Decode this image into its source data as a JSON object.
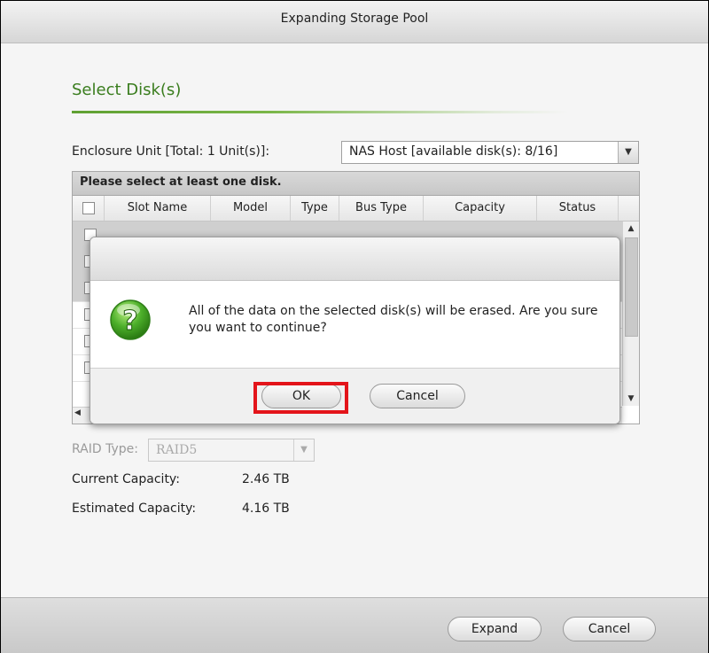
{
  "window": {
    "title": "Expanding Storage Pool"
  },
  "section": {
    "title": "Select Disk(s)"
  },
  "enclosure": {
    "label": "Enclosure Unit [Total: 1 Unit(s)]:",
    "selected": "NAS Host [available disk(s): 8/16]"
  },
  "disk_table": {
    "hint": "Please select at least one disk.",
    "columns": [
      "Slot Name",
      "Model",
      "Type",
      "Bus Type",
      "Capacity",
      "Status"
    ]
  },
  "raid": {
    "label": "RAID Type:",
    "value": "RAID5"
  },
  "capacity": {
    "current_label": "Current Capacity:",
    "current_value": "2.46 TB",
    "estimated_label": "Estimated Capacity:",
    "estimated_value": "4.16 TB"
  },
  "footer": {
    "expand_label": "Expand",
    "cancel_label": "Cancel"
  },
  "dialog": {
    "message": "All of the data on the selected disk(s) will be erased. Are you sure you want to continue?",
    "ok_label": "OK",
    "cancel_label": "Cancel"
  },
  "colors": {
    "accent_green": "#3a7d1e",
    "highlight_red": "#e3141a",
    "question_icon_green": "#4caf2a"
  },
  "icons": {
    "dialog": "question-icon"
  }
}
